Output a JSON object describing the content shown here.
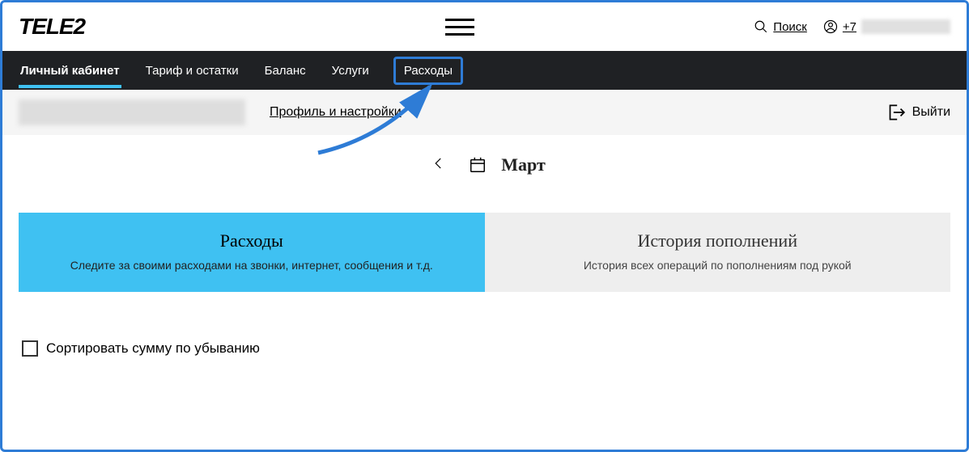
{
  "brand": "TELE2",
  "topbar": {
    "search_label": "Поиск",
    "user_prefix": "+7"
  },
  "nav": {
    "items": [
      {
        "label": "Личный кабинет"
      },
      {
        "label": "Тариф и остатки"
      },
      {
        "label": "Баланс"
      },
      {
        "label": "Услуги"
      },
      {
        "label": "Расходы"
      }
    ]
  },
  "subbar": {
    "profile_link": "Профиль и настройки",
    "logout_label": "Выйти"
  },
  "month": {
    "label": "Март"
  },
  "tabs": {
    "expenses": {
      "title": "Расходы",
      "desc": "Следите за своими расходами на звонки, интернет, сообщения и т.д."
    },
    "history": {
      "title": "История пополнений",
      "desc": "История всех операций по пополнениям под рукой"
    }
  },
  "sort": {
    "label": "Сортировать сумму по убыванию"
  }
}
